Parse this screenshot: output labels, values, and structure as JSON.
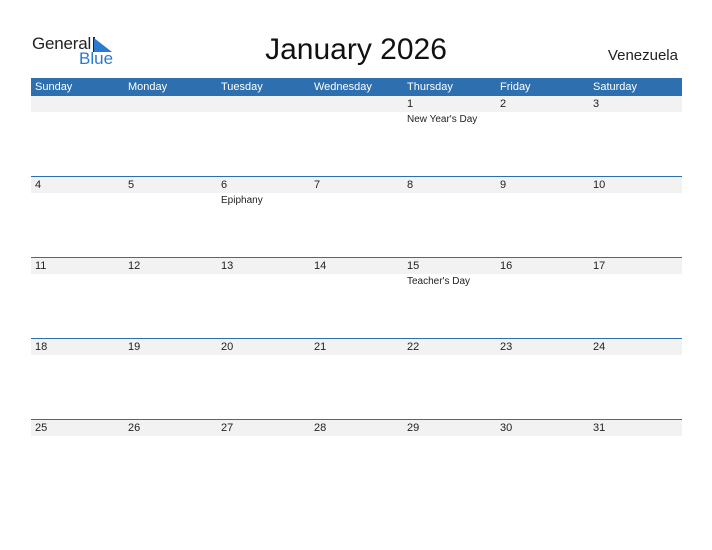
{
  "logo": {
    "line1": "General",
    "line2": "Blue"
  },
  "title": "January 2026",
  "country": "Venezuela",
  "colors": {
    "accent": "#2e6fb0",
    "strip": "#f2f2f2",
    "logo_blue": "#2a7bd0"
  },
  "weekdays": [
    "Sunday",
    "Monday",
    "Tuesday",
    "Wednesday",
    "Thursday",
    "Friday",
    "Saturday"
  ],
  "weeks": [
    [
      {
        "day": "",
        "holiday": ""
      },
      {
        "day": "",
        "holiday": ""
      },
      {
        "day": "",
        "holiday": ""
      },
      {
        "day": "",
        "holiday": ""
      },
      {
        "day": "1",
        "holiday": "New Year's Day"
      },
      {
        "day": "2",
        "holiday": ""
      },
      {
        "day": "3",
        "holiday": ""
      }
    ],
    [
      {
        "day": "4",
        "holiday": ""
      },
      {
        "day": "5",
        "holiday": ""
      },
      {
        "day": "6",
        "holiday": "Epiphany"
      },
      {
        "day": "7",
        "holiday": ""
      },
      {
        "day": "8",
        "holiday": ""
      },
      {
        "day": "9",
        "holiday": ""
      },
      {
        "day": "10",
        "holiday": ""
      }
    ],
    [
      {
        "day": "11",
        "holiday": ""
      },
      {
        "day": "12",
        "holiday": ""
      },
      {
        "day": "13",
        "holiday": ""
      },
      {
        "day": "14",
        "holiday": ""
      },
      {
        "day": "15",
        "holiday": "Teacher's Day"
      },
      {
        "day": "16",
        "holiday": ""
      },
      {
        "day": "17",
        "holiday": ""
      }
    ],
    [
      {
        "day": "18",
        "holiday": ""
      },
      {
        "day": "19",
        "holiday": ""
      },
      {
        "day": "20",
        "holiday": ""
      },
      {
        "day": "21",
        "holiday": ""
      },
      {
        "day": "22",
        "holiday": ""
      },
      {
        "day": "23",
        "holiday": ""
      },
      {
        "day": "24",
        "holiday": ""
      }
    ],
    [
      {
        "day": "25",
        "holiday": ""
      },
      {
        "day": "26",
        "holiday": ""
      },
      {
        "day": "27",
        "holiday": ""
      },
      {
        "day": "28",
        "holiday": ""
      },
      {
        "day": "29",
        "holiday": ""
      },
      {
        "day": "30",
        "holiday": ""
      },
      {
        "day": "31",
        "holiday": ""
      }
    ]
  ]
}
